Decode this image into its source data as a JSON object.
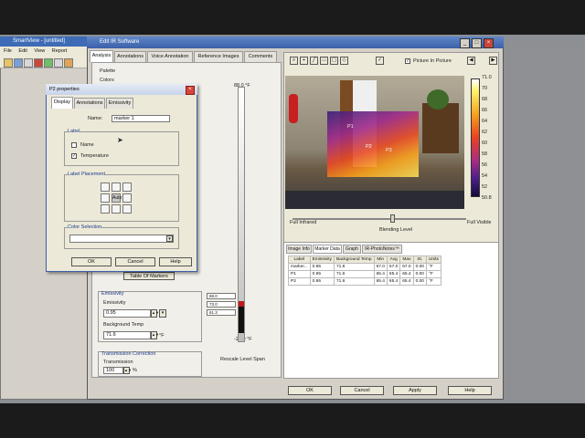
{
  "bg_window": {
    "title": "SmartView - [untitled]",
    "menu": [
      "File",
      "Edit",
      "View",
      "Report"
    ]
  },
  "main_window": {
    "title": "Edit IR Software"
  },
  "tabs": [
    "Analysis",
    "Annotations",
    "Voice Annotation",
    "Reference Images",
    "Comments"
  ],
  "left_panel": {
    "palette_label": "Palette",
    "colors_label": "Colors",
    "table_button": "Table Of Markers",
    "emissivity_group": "Emissivity",
    "emissivity_label": "Emissivity",
    "emissivity_value": "0.95",
    "bg_temp_label": "Background Temp",
    "bg_temp_value": "71.6",
    "transmission_group": "Transmission Correction",
    "transmission_label": "Transmission",
    "transmission_value": "100",
    "transmission_unit": "%",
    "scale_top": "88.0 °F",
    "scale_bottom": "-22.0 °F",
    "scale_marks": [
      "88.0",
      "73.0",
      "61.3"
    ],
    "rescale_label": "Rescale   Level   Span"
  },
  "viewer": {
    "pip_label": "Picture In Picture",
    "full_infrared": "Full Infrared",
    "full_visible": "Full Visible",
    "blending_level": "Blending Level",
    "palette_ticks": [
      "71.0",
      "70",
      "68",
      "66",
      "64",
      "62",
      "60",
      "58",
      "56",
      "54",
      "52",
      "50.8"
    ],
    "markers": [
      "P1",
      "P2",
      "P3"
    ]
  },
  "data_panel": {
    "tabs": [
      "Image Info",
      "Marker Data",
      "Graph",
      "IR-PhotoNotes™"
    ],
    "columns": [
      "Label",
      "Emissivity",
      "Background Temp",
      "Min",
      "Avg",
      "Max",
      "St.",
      "Units"
    ],
    "rows": [
      [
        "marker...",
        "0.95",
        "71.6",
        "67.0",
        "67.0",
        "67.0",
        "0.00",
        "°F"
      ],
      [
        "P1",
        "0.95",
        "71.6",
        "65.4",
        "65.4",
        "65.4",
        "0.00",
        "°F"
      ],
      [
        "P2",
        "0.95",
        "71.6",
        "65.4",
        "65.4",
        "65.4",
        "0.00",
        "°F"
      ]
    ]
  },
  "dialog": {
    "title": "P2 properties",
    "tabs": [
      "Display",
      "Annotations",
      "Emissivity"
    ],
    "name_label": "Name:",
    "name_value": "marker 1",
    "label_group": "Label",
    "name_option": "Name",
    "temperature_option": "Temperature",
    "placement_group": "Label Placement",
    "auto_label": "Auto",
    "color_group": "Color Selection",
    "ok": "OK",
    "cancel": "Cancel",
    "help": "Help"
  },
  "bottom_buttons": {
    "ok": "OK",
    "cancel": "Cancel",
    "apply": "Apply",
    "help": "Help"
  }
}
